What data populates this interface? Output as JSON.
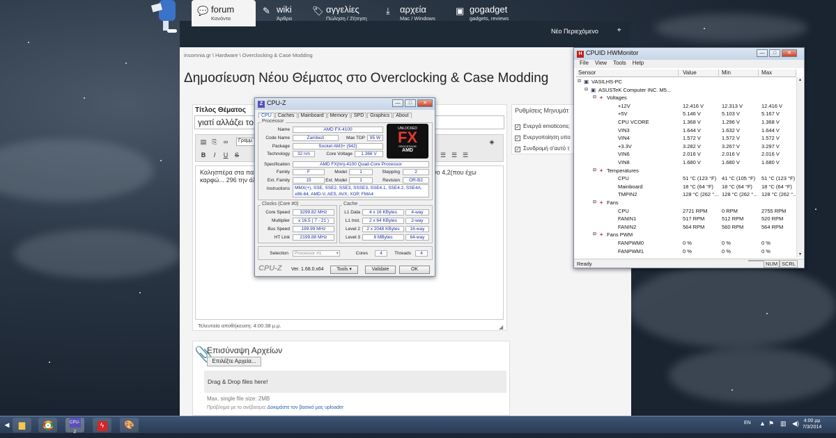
{
  "nav": {
    "tabs": [
      {
        "title": "forum",
        "sub": "Κανόντα",
        "icon": "chat-icon"
      },
      {
        "title": "wiki",
        "sub": "Άρθρα",
        "icon": "edit-icon"
      },
      {
        "title": "αγγελίες",
        "sub": "Πώληση / Ζήτηση",
        "icon": "tag-icon"
      },
      {
        "title": "αρχεία",
        "sub": "Mac / Windows",
        "icon": "download-icon"
      },
      {
        "title": "gogadget",
        "sub": "gadgets, reviews",
        "icon": "gadget-icon"
      }
    ],
    "new_content": "Νέο Περιεχόμενο"
  },
  "breadcrumb": "insomnia.gr  \\  Hardware  \\  Overclocking & Case Modding",
  "page_title": "Δημοσίευση Νέου Θέματος στο Overclocking & Case Modding",
  "form": {
    "subject_label": "Τίτλος Θέματος",
    "subject_value": "γιατί αλλάζει το c",
    "toolbar_font": "Γραμμ",
    "message": "Καλησπέρα στα πα... θαθώ να το πάω στα 4,2 τον cpu αλλά ότ... 3,3 και μετά από λίγο 4,2(που έχω καρφώ... 296 την άλλη 1.368 (που έχω καρφώσ...",
    "last_saved": "Τελευταία αποθήκευση: 4:00:38 μ.μ."
  },
  "options": {
    "title": "Ρυθμίσεις Μηνυμάτ",
    "items": [
      "Ενεργά emoticons;",
      "Ενεργοποίηση υπο",
      "Συνδρομή σ'αυτό τ"
    ]
  },
  "attach": {
    "title": "Επισύναψη Αρχείων",
    "button": "Επιλέξτε Αρχεία...",
    "drop": "Drag & Drop files here!",
    "max": "Max. single file size: 2MB",
    "try_prefix": "Πρόβλημα με το ανέβασμα; ",
    "try_link": "Δοκιμάστε τον βασικό μας uploader"
  },
  "cpuz": {
    "title": "CPU-Z",
    "tabs": [
      "CPU",
      "Caches",
      "Mainboard",
      "Memory",
      "SPD",
      "Graphics",
      "About"
    ],
    "processor_label": "Processor",
    "name_label": "Name",
    "name": "AMD FX-4100",
    "code_label": "Code Name",
    "code": "Zambezi",
    "tdp_label": "Max TDP",
    "tdp": "95 W",
    "pkg_label": "Package",
    "pkg": "Socket AM3+ (942)",
    "tech_label": "Technology",
    "tech": "32 nm",
    "cv_label": "Core Voltage",
    "cv": "1.368 V",
    "spec_label": "Specification",
    "spec": "AMD FX(tm)-4100 Quad-Core Processor",
    "family_label": "Family",
    "family": "F",
    "model_label": "Model",
    "model": "1",
    "stepping_label": "Stepping",
    "stepping": "2",
    "extfam_label": "Ext. Family",
    "extfam": "15",
    "extmodel_label": "Ext. Model",
    "extmodel": "1",
    "rev_label": "Revision",
    "rev": "OR-B2",
    "instr_label": "Instructions",
    "instr1": "MMX(+), SSE, SSE2, SSE3, SSSE3, SSE4.1, SSE4.2, SSE4A,",
    "instr2": "x86-64, AMD-V, AES, AVX, XOP, FMA4",
    "clocks_label": "Clocks (Core #0)",
    "cs_label": "Core Speed",
    "cs": "3299.82 MHz",
    "mult_label": "Multiplier",
    "mult": "x 16.5 ( 7 - 21 )",
    "bus_label": "Bus Speed",
    "bus": "199.99 MHz",
    "ht_label": "HT Link",
    "ht": "2199.88 MHz",
    "cache_label": "Cache",
    "l1d_label": "L1 Data",
    "l1d": "4 x 16 KBytes",
    "l1d_w": "4-way",
    "l1i_label": "L1 Inst.",
    "l1i": "2 x 64 KBytes",
    "l1i_w": "2-way",
    "l2_label": "Level 2",
    "l2": "2 x 2048 KBytes",
    "l2_w": "16-way",
    "l3_label": "Level 3",
    "l3": "8 MBytes",
    "l3_w": "64-way",
    "sel_label": "Selection",
    "sel": "Processor #1",
    "cores_label": "Cores",
    "cores": "4",
    "threads_label": "Threads",
    "threads": "4",
    "brand": "CPU-Z",
    "version": "Ver. 1.68.0.x64",
    "tools": "Tools",
    "validate": "Validate",
    "ok": "OK",
    "logo_top": "UNLOCKED",
    "logo_fx": "FX",
    "logo_sub": "PROCESSOR",
    "logo_amd": "AMD"
  },
  "hwmon": {
    "title": "CPUID HWMonitor",
    "menu": [
      "File",
      "View",
      "Tools",
      "Help"
    ],
    "cols": [
      "Sensor",
      "Value",
      "Min",
      "Max"
    ],
    "rows": [
      {
        "ind": 0,
        "name": "VASILHS-PC",
        "v": "",
        "mn": "",
        "mx": ""
      },
      {
        "ind": 1,
        "name": "ASUSTeK Computer INC. M5...",
        "v": "",
        "mn": "",
        "mx": ""
      },
      {
        "ind": 2,
        "name": "Voltages",
        "v": "",
        "mn": "",
        "mx": ""
      },
      {
        "ind": 3,
        "name": "+12V",
        "v": "12.416 V",
        "mn": "12.313 V",
        "mx": "12.416 V"
      },
      {
        "ind": 3,
        "name": "+5V",
        "v": "5.146 V",
        "mn": "5.103 V",
        "mx": "5.167 V"
      },
      {
        "ind": 3,
        "name": "CPU VCORE",
        "v": "1.368 V",
        "mn": "1.296 V",
        "mx": "1.368 V"
      },
      {
        "ind": 3,
        "name": "VIN3",
        "v": "1.644 V",
        "mn": "1.632 V",
        "mx": "1.644 V"
      },
      {
        "ind": 3,
        "name": "VIN4",
        "v": "1.572 V",
        "mn": "1.572 V",
        "mx": "1.572 V"
      },
      {
        "ind": 3,
        "name": "+3.3V",
        "v": "3.282 V",
        "mn": "3.267 V",
        "mx": "3.297 V"
      },
      {
        "ind": 3,
        "name": "VIN6",
        "v": "2.016 V",
        "mn": "2.016 V",
        "mx": "2.016 V"
      },
      {
        "ind": 3,
        "name": "VIN8",
        "v": "1.680 V",
        "mn": "1.680 V",
        "mx": "1.680 V"
      },
      {
        "ind": 2,
        "name": "Temperatures",
        "v": "",
        "mn": "",
        "mx": ""
      },
      {
        "ind": 3,
        "name": "CPU",
        "v": "51 °C (123 °F)",
        "mn": "41 °C (105 °F)",
        "mx": "51 °C (123 °F)"
      },
      {
        "ind": 3,
        "name": "Mainboard",
        "v": "18 °C (64 °F)",
        "mn": "18 °C (64 °F)",
        "mx": "18 °C (64 °F)"
      },
      {
        "ind": 3,
        "name": "TMPIN2",
        "v": "128 °C (262 °...",
        "mn": "128 °C (262 °...",
        "mx": "128 °C (262 °..."
      },
      {
        "ind": 2,
        "name": "Fans",
        "v": "",
        "mn": "",
        "mx": ""
      },
      {
        "ind": 3,
        "name": "CPU",
        "v": "2721 RPM",
        "mn": "0 RPM",
        "mx": "2755 RPM"
      },
      {
        "ind": 3,
        "name": "FANIN1",
        "v": "517 RPM",
        "mn": "512 RPM",
        "mx": "520 RPM"
      },
      {
        "ind": 3,
        "name": "FANIN2",
        "v": "564 RPM",
        "mn": "560 RPM",
        "mx": "564 RPM"
      },
      {
        "ind": 2,
        "name": "Fans PWM",
        "v": "",
        "mn": "",
        "mx": ""
      },
      {
        "ind": 3,
        "name": "FANPWM0",
        "v": "0 %",
        "mn": "0 %",
        "mx": "0 %"
      },
      {
        "ind": 3,
        "name": "FANPWM1",
        "v": "0 %",
        "mn": "0 %",
        "mx": "0 %"
      }
    ],
    "status": "Ready",
    "num": "NUM",
    "scrl": "SCRL"
  },
  "taskbar": {
    "lang": "EN",
    "time": "4:00 μμ",
    "date": "7/3/2014"
  }
}
